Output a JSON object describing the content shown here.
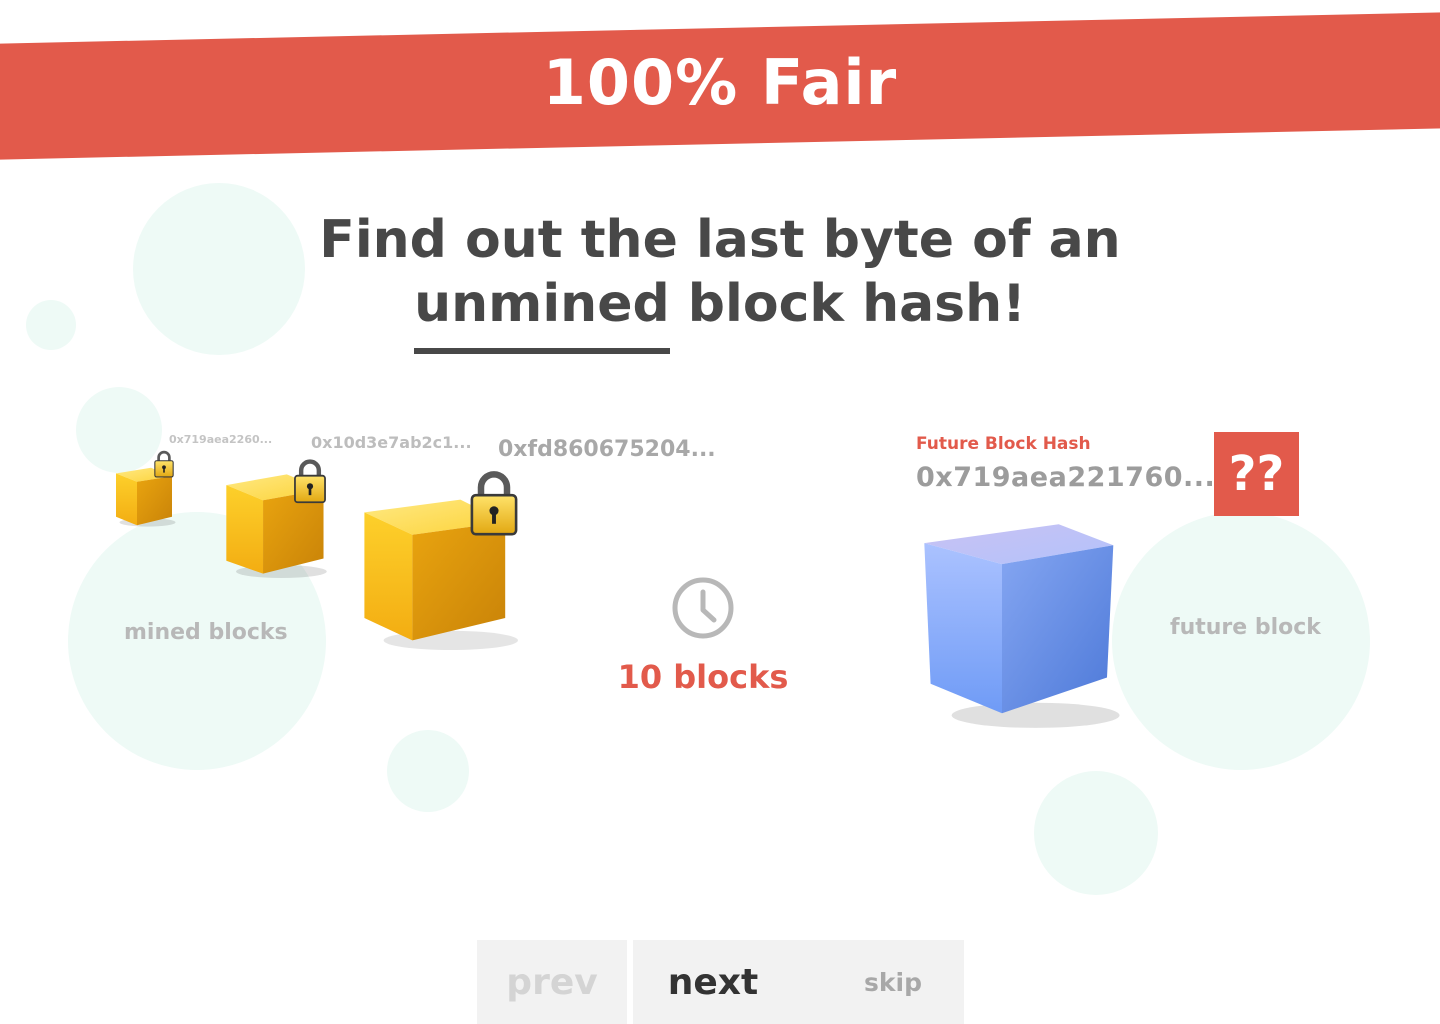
{
  "banner": {
    "title": "100% Fair"
  },
  "headline": {
    "line1": "Find out the last byte of an",
    "underlined": "unmined",
    "rest": " block hash!"
  },
  "mined": {
    "hashes": [
      "0x719aea2260...",
      "0x10d3e7ab2c1...",
      "0xfd860675204..."
    ],
    "label": "mined blocks"
  },
  "wait": {
    "count_label": "10 blocks",
    "icon": "clock-icon"
  },
  "future": {
    "title": "Future Block Hash",
    "hash": "0x719aea221760...",
    "unknown": "??",
    "label": "future block"
  },
  "nav": {
    "prev": "prev",
    "next": "next",
    "skip": "skip"
  },
  "colors": {
    "accent": "#e25a4b",
    "bubble": "#eefaf6",
    "gold": "#f7c21a",
    "blue": "#8fb2ff"
  }
}
